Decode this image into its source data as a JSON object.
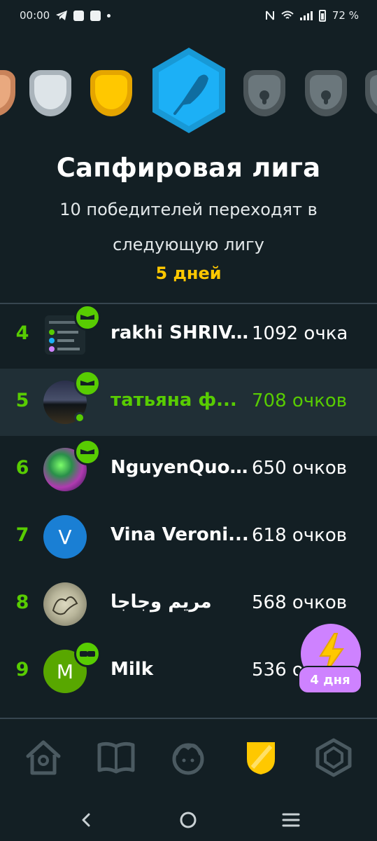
{
  "status_bar": {
    "time": "00:00",
    "battery": "72 %"
  },
  "league": {
    "title": "Сапфировая лига",
    "subtitle": "10 победителей переходят в следующую лигу",
    "days_left": "5 дней",
    "current_color": "#1cb0f6"
  },
  "leaderboard": [
    {
      "rank": "4",
      "name": "rakhi SHRIV...",
      "score": "1092 очка",
      "is_me": false
    },
    {
      "rank": "5",
      "name": "татьяна ф...",
      "score": "708 очков",
      "is_me": true
    },
    {
      "rank": "6",
      "name": "NguyenQuo...",
      "score": "650 очков",
      "is_me": false
    },
    {
      "rank": "7",
      "name": "Vina Veroni...",
      "score": "618 очков",
      "is_me": false,
      "avatar_letter": "V"
    },
    {
      "rank": "8",
      "name": "مريم وجاجا",
      "score": "568 очков",
      "is_me": false
    },
    {
      "rank": "9",
      "name": "Milk",
      "score": "536 очков",
      "is_me": false,
      "avatar_letter": "M"
    }
  ],
  "promo": {
    "label": "4 дня",
    "icon": "lightning-icon"
  },
  "bottom_nav": [
    {
      "icon": "home-icon",
      "active": false
    },
    {
      "icon": "book-icon",
      "active": false
    },
    {
      "icon": "character-icon",
      "active": false
    },
    {
      "icon": "league-shield-icon",
      "active": true
    },
    {
      "icon": "hexagon-icon",
      "active": false
    }
  ],
  "colors": {
    "background": "#131f24",
    "accent_green": "#58cc02",
    "gold": "#ffc800",
    "highlight_row": "#202f36"
  }
}
